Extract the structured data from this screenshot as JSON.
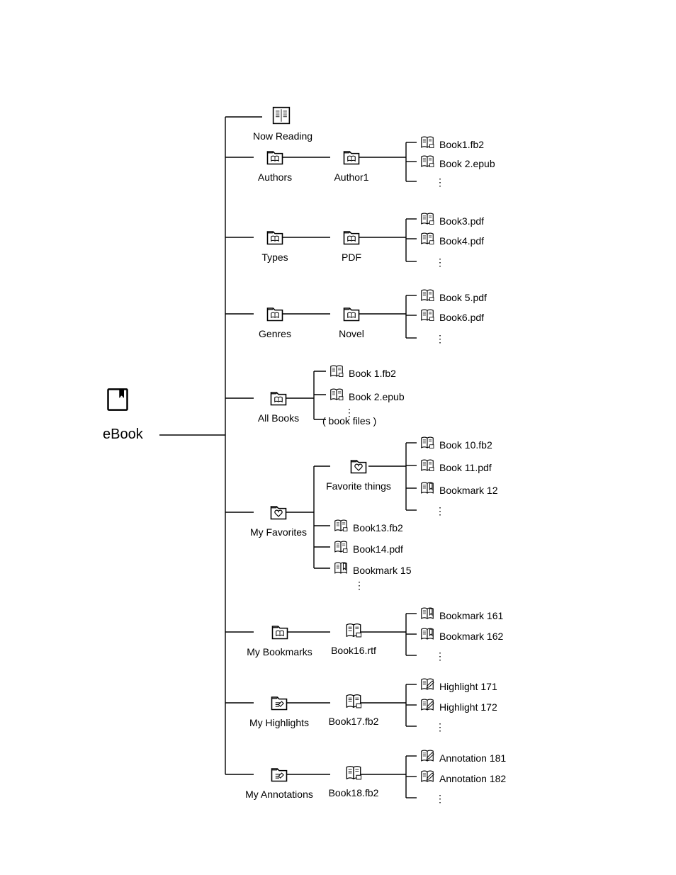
{
  "root": {
    "label": "eBook"
  },
  "nodes": {
    "now_reading": {
      "label": "Now Reading"
    },
    "authors": {
      "label": "Authors"
    },
    "author1": {
      "label": "Author1"
    },
    "types": {
      "label": "Types"
    },
    "pdf": {
      "label": "PDF"
    },
    "genres": {
      "label": "Genres"
    },
    "novel": {
      "label": "Novel"
    },
    "all_books": {
      "label": "All Books"
    },
    "book_files": {
      "label": "( book files )"
    },
    "my_favorites": {
      "label": "My Favorites"
    },
    "favorite_things": {
      "label": "Favorite things"
    },
    "my_bookmarks": {
      "label": "My Bookmarks"
    },
    "book16": {
      "label": "Book16.rtf"
    },
    "my_highlights": {
      "label": "My Highlights"
    },
    "book17": {
      "label": "Book17.fb2"
    },
    "my_annotations": {
      "label": "My Annotations"
    },
    "book18": {
      "label": "Book18.fb2"
    }
  },
  "leaves": {
    "b1": "Book1.fb2",
    "b2": "Book 2.epub",
    "b3": "Book3.pdf",
    "b4": "Book4.pdf",
    "b5": "Book 5.pdf",
    "b6": "Book6.pdf",
    "ab1": "Book 1.fb2",
    "ab2": "Book 2.epub",
    "f10": "Book 10.fb2",
    "f11": "Book 11.pdf",
    "f12": "Bookmark 12",
    "f13": "Book13.fb2",
    "f14": "Book14.pdf",
    "f15": "Bookmark 15",
    "bm161": "Bookmark 161",
    "bm162": "Bookmark 162",
    "hl171": "Highlight 171",
    "hl172": "Highlight 172",
    "an181": "Annotation 181",
    "an182": "Annotation 182"
  },
  "vdots": "⋮"
}
